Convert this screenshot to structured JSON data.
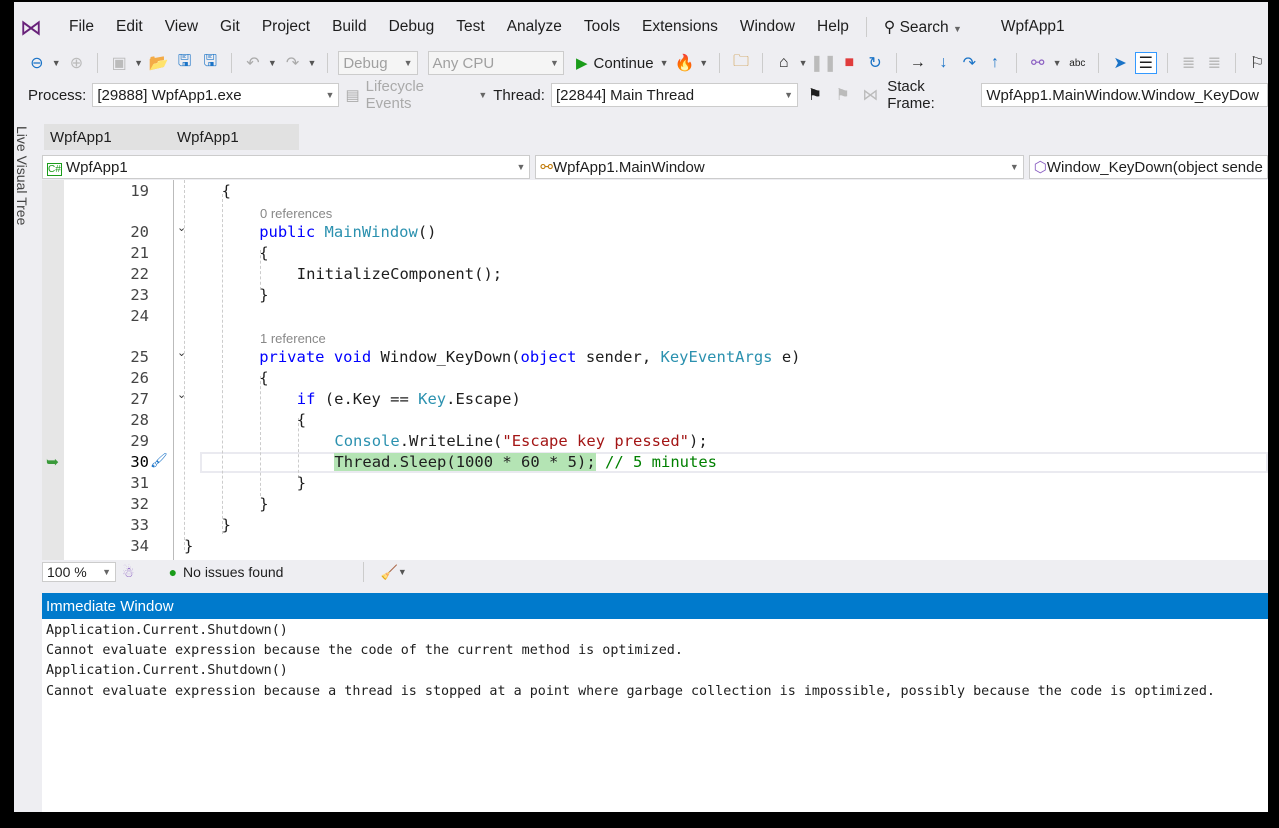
{
  "menu": [
    "File",
    "Edit",
    "View",
    "Git",
    "Project",
    "Build",
    "Debug",
    "Test",
    "Analyze",
    "Tools",
    "Extensions",
    "Window",
    "Help"
  ],
  "search_label": "Search",
  "solution_title": "WpfApp1",
  "toolbar": {
    "config": "Debug",
    "platform": "Any CPU",
    "continue": "Continue"
  },
  "debugbar": {
    "process_label": "Process:",
    "process": "[29888] WpfApp1.exe",
    "lifecycle": "Lifecycle Events",
    "thread_label": "Thread:",
    "thread": "[22844] Main Thread",
    "stack_label": "Stack Frame:",
    "stack": "WpfApp1.MainWindow.Window_KeyDow"
  },
  "side_panel": "Live Visual Tree",
  "tabs": [
    "WpfApp1",
    "WpfApp1"
  ],
  "nav": {
    "project": "WpfApp1",
    "class": "WpfApp1.MainWindow",
    "member": "Window_KeyDown(object sende"
  },
  "code": [
    {
      "n": "19",
      "indent": 1,
      "tokens": [
        [
          "{",
          "mt"
        ]
      ]
    },
    {
      "ref": "0 references"
    },
    {
      "n": "20",
      "indent": 2,
      "fold": true,
      "tokens": [
        [
          "public ",
          "kw"
        ],
        [
          "MainWindow",
          "ty"
        ],
        [
          "()",
          "mt"
        ]
      ]
    },
    {
      "n": "21",
      "indent": 2,
      "tokens": [
        [
          "{",
          "mt"
        ]
      ]
    },
    {
      "n": "22",
      "indent": 3,
      "tokens": [
        [
          "InitializeComponent",
          "mt"
        ],
        [
          "();",
          "mt"
        ]
      ]
    },
    {
      "n": "23",
      "indent": 2,
      "tokens": [
        [
          "}",
          "mt"
        ]
      ]
    },
    {
      "n": "24",
      "indent": 0,
      "tokens": []
    },
    {
      "ref": "1 reference"
    },
    {
      "n": "25",
      "indent": 2,
      "fold": true,
      "tokens": [
        [
          "private ",
          "kw"
        ],
        [
          "void ",
          "kw"
        ],
        [
          "Window_KeyDown",
          "mt"
        ],
        [
          "(",
          "mt"
        ],
        [
          "object ",
          "kw"
        ],
        [
          "sender, ",
          "mt"
        ],
        [
          "KeyEventArgs",
          "ty"
        ],
        [
          " e)",
          "mt"
        ]
      ]
    },
    {
      "n": "26",
      "indent": 2,
      "tokens": [
        [
          "{",
          "mt"
        ]
      ]
    },
    {
      "n": "27",
      "indent": 3,
      "fold": true,
      "tokens": [
        [
          "if ",
          "kw"
        ],
        [
          "(e.Key == ",
          "mt"
        ],
        [
          "Key",
          "ty"
        ],
        [
          ".Escape)",
          "mt"
        ]
      ]
    },
    {
      "n": "28",
      "indent": 3,
      "tokens": [
        [
          "{",
          "mt"
        ]
      ]
    },
    {
      "n": "29",
      "indent": 4,
      "tokens": [
        [
          "Console",
          "ty"
        ],
        [
          ".WriteLine(",
          "mt"
        ],
        [
          "\"Escape key pressed\"",
          "st"
        ],
        [
          ");",
          "mt"
        ]
      ]
    },
    {
      "n": "30",
      "indent": 4,
      "current": true,
      "tokens": [
        [
          "Thread.Sleep(1000 * 60 * 5);",
          "hl"
        ],
        [
          " // 5 minutes",
          "cm"
        ]
      ]
    },
    {
      "n": "31",
      "indent": 3,
      "tokens": [
        [
          "}",
          "mt"
        ]
      ]
    },
    {
      "n": "32",
      "indent": 2,
      "tokens": [
        [
          "}",
          "mt"
        ]
      ]
    },
    {
      "n": "33",
      "indent": 1,
      "tokens": [
        [
          "}",
          "mt"
        ]
      ]
    },
    {
      "n": "34",
      "indent": 0,
      "tokens": [
        [
          "}",
          "mt"
        ]
      ]
    }
  ],
  "status": {
    "zoom": "100 %",
    "issues": "No issues found"
  },
  "immediate": {
    "title": "Immediate Window",
    "lines": [
      "Application.Current.Shutdown()",
      "Cannot evaluate expression because the code of the current method is optimized.",
      "Application.Current.Shutdown()",
      "Cannot evaluate expression because a thread is stopped at a point where garbage collection is impossible, possibly because the code is optimized."
    ]
  }
}
